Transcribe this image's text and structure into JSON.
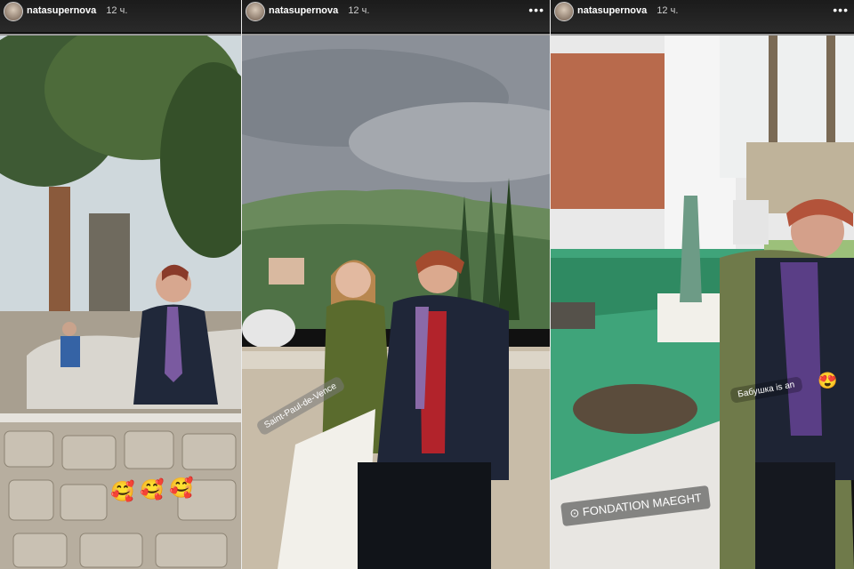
{
  "stories": [
    {
      "username": "natasupernova",
      "time": "12 ч.",
      "show_menu": false
    },
    {
      "username": "natasupernova",
      "time": "12 ч.",
      "show_menu": true,
      "sticker": "Saint-Paul-de-Vence"
    },
    {
      "username": "natasupernova",
      "time": "12 ч.",
      "show_menu": true,
      "caption": "Бабушка is an",
      "location": "FONDATION MAEGHT"
    }
  ],
  "icons": {
    "menu": "more-icon",
    "location": "location-pin-icon"
  },
  "emojis": [
    "🥰",
    "🥰",
    "🥰"
  ],
  "emoji_single": "😍",
  "colors": {
    "header_bg": "#1b1b1b",
    "progress": "#9a9a9a"
  }
}
